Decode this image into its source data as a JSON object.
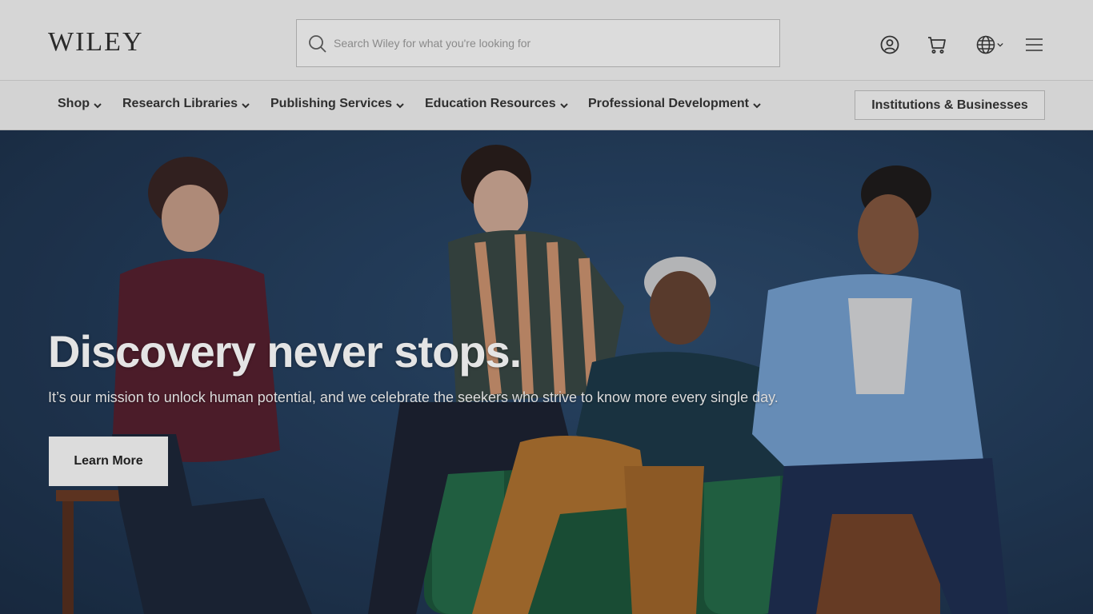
{
  "header": {
    "logo_text": "WILEY",
    "search_placeholder": "Search Wiley for what you're looking for",
    "icons": [
      "search-icon",
      "account-icon",
      "cart-icon",
      "globe-icon",
      "menu-icon"
    ]
  },
  "nav": {
    "items": [
      {
        "label": "Shop"
      },
      {
        "label": "Research Libraries"
      },
      {
        "label": "Publishing Services"
      },
      {
        "label": "Education Resources"
      },
      {
        "label": "Professional Development"
      }
    ],
    "institutions_label": "Institutions & Businesses"
  },
  "hero": {
    "title": "Discovery never stops.",
    "subtitle": "It’s our mission to unlock human potential, and we celebrate the seekers who strive to know more every single day.",
    "cta_label": "Learn More"
  },
  "colors": {
    "header_bg": "#d6d6d6",
    "hero_bg": "#25405f",
    "text_dark": "#2f2f2f",
    "hero_text": "#e4e4e4"
  }
}
